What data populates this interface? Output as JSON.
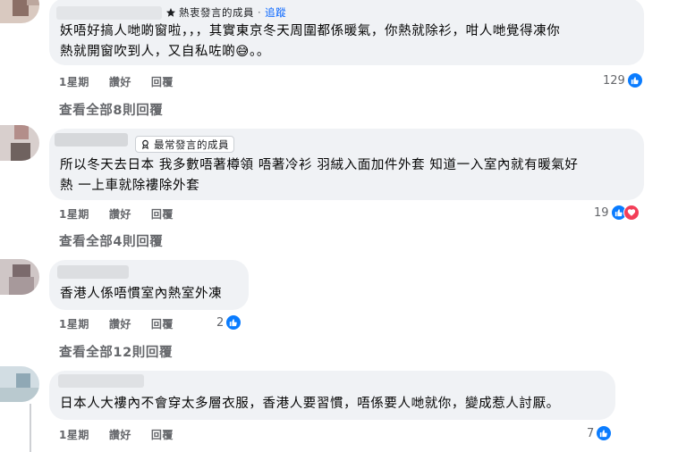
{
  "comments": [
    {
      "badge": {
        "icon": "star-icon",
        "label": "熱衷發言的成員",
        "separator": "·",
        "follow": "追蹤"
      },
      "text_lines": [
        "妖唔好搞人哋啲窗啦，，，其實東京冬天周圍都係暖氣，你熱就除衫，咁人哋覺得凍你",
        "熱就開窗吹到人，又自私咗啲😅。。"
      ],
      "time": "1星期",
      "like_action": "讚好",
      "reply_action": "回覆",
      "reaction_count": "129",
      "reactions": [
        "like-icon"
      ],
      "view_replies": "查看全部8則回覆"
    },
    {
      "badge": {
        "icon": "trophy-icon",
        "label": "最常發言的成員"
      },
      "text_lines": [
        "所以冬天去日本 我多數唔著樽領 唔著冷衫 羽絨入面加件外套 知道一入室內就有暖氣好",
        "熱 一上車就除褸除外套"
      ],
      "time": "1星期",
      "like_action": "讚好",
      "reply_action": "回覆",
      "reaction_count": "19",
      "reactions": [
        "like-icon",
        "love-icon"
      ],
      "view_replies": "查看全部4則回覆"
    },
    {
      "text_lines": [
        "香港人係唔慣室內熱室外凍"
      ],
      "time": "1星期",
      "like_action": "讚好",
      "reply_action": "回覆",
      "reaction_count": "2",
      "reactions": [
        "like-icon"
      ],
      "view_replies": "查看全部12則回覆"
    },
    {
      "text_lines": [
        "日本人大褸內不會穿太多層衣服，香港人要習慣，唔係要人哋就你，變成惹人討厭。"
      ],
      "time": "1星期",
      "like_action": "讚好",
      "reply_action": "回覆",
      "reaction_count": "7",
      "reactions": [
        "like-icon"
      ]
    }
  ],
  "colors": {
    "bubble": "#f0f2f5",
    "link": "#0866ff",
    "like": "#0a7cff",
    "love": "#f33e58",
    "meta": "#65676b"
  }
}
